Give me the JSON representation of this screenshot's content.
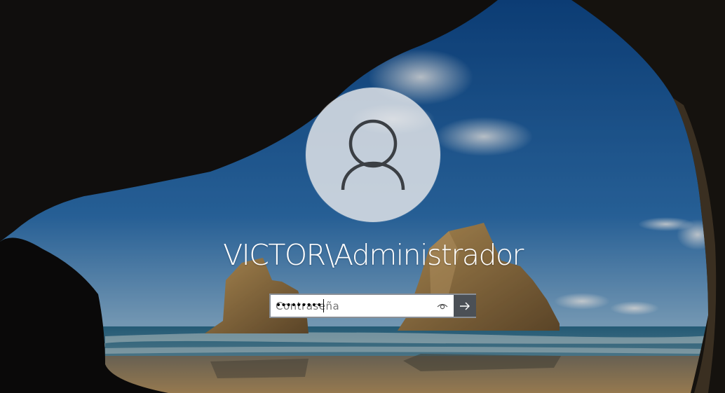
{
  "login": {
    "username": "VICTOR\\Administrador",
    "password_masked": "•••••••••",
    "password_placeholder": "Contraseña"
  },
  "icons": {
    "avatar": "user-silhouette-icon",
    "reveal": "eye-icon",
    "submit": "arrow-right-icon"
  },
  "colors": {
    "sky": "#1e5a9a",
    "avatar_bg": "#dee2e7",
    "avatar_icon": "#3b3f44",
    "submit_bg": "#4b5056",
    "text": "#ffffff"
  }
}
